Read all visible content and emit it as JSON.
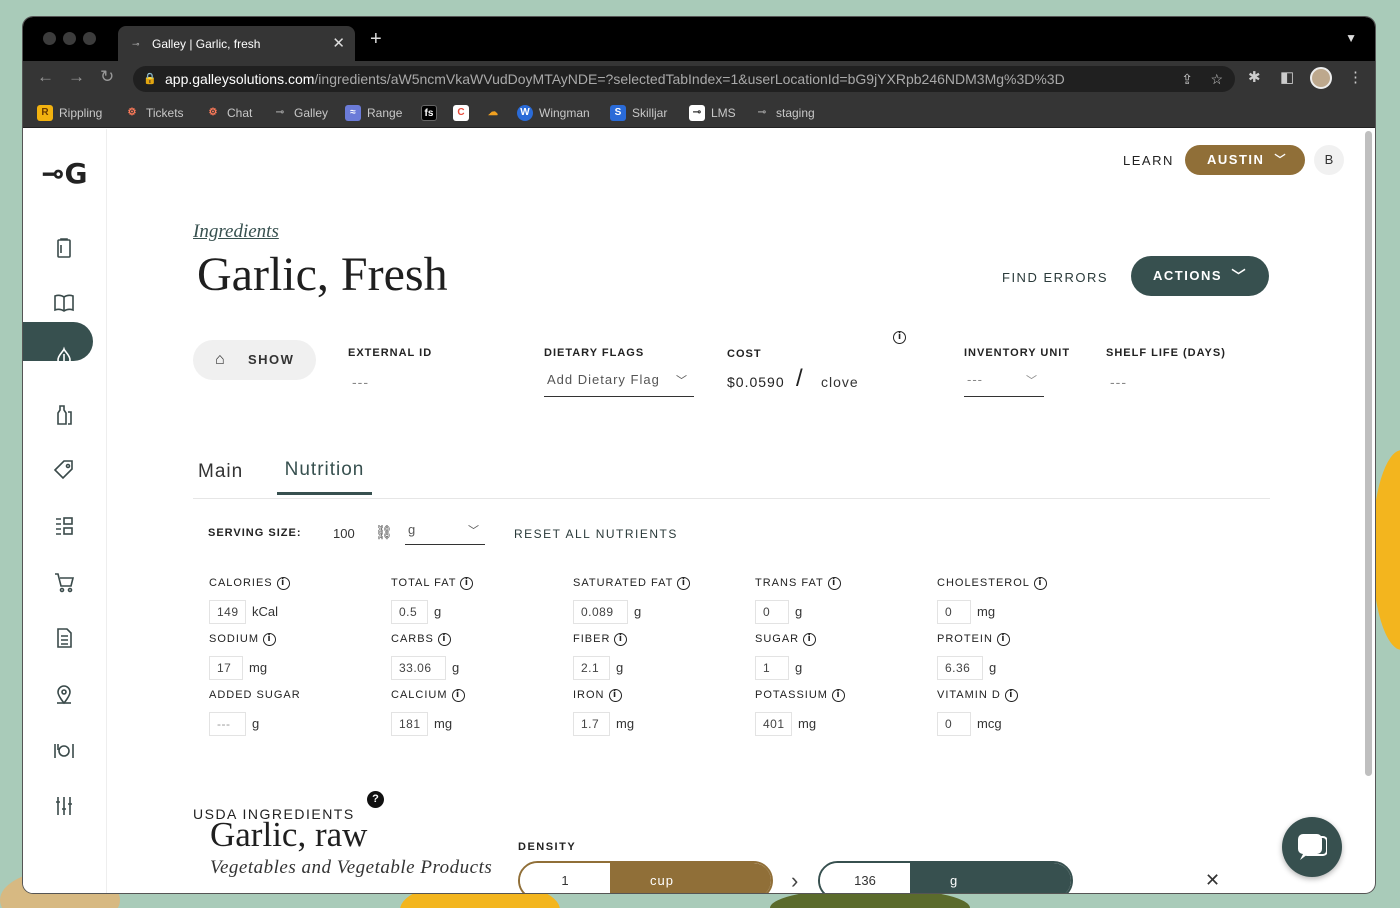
{
  "browser": {
    "tab_title": "Galley | Garlic, fresh",
    "url_host": "app.galleysolutions.com",
    "url_path": "/ingredients/aW5ncmVkaWVudDoyMTAyNDE=?selectedTabIndex=1&userLocationId=bG9jYXRpb246NDM3Mg%3D%3D",
    "bookmarks": [
      {
        "label": "Rippling",
        "icon": "rippling-icon",
        "color": "#f2b20f"
      },
      {
        "label": "Tickets",
        "icon": "hubspot-icon",
        "color": "#ff7a59"
      },
      {
        "label": "Chat",
        "icon": "hubspot-icon",
        "color": "#ff7a59"
      },
      {
        "label": "Galley",
        "icon": "galley-icon",
        "color": "#999999"
      },
      {
        "label": "Range",
        "icon": "range-icon",
        "color": "#6b7bd8"
      },
      {
        "label": "",
        "icon": "fullstory-icon",
        "color": "#000000"
      },
      {
        "label": "",
        "icon": "calendar-icon",
        "color": "#e84a3a"
      },
      {
        "label": "",
        "icon": "cloud-icon",
        "color": "#f0a020"
      },
      {
        "label": "Wingman",
        "icon": "wingman-icon",
        "color": "#2a6bd8"
      },
      {
        "label": "Skilljar",
        "icon": "skilljar-icon",
        "color": "#2a6bd8"
      },
      {
        "label": "LMS",
        "icon": "lms-icon",
        "color": "#ffffff"
      },
      {
        "label": "staging",
        "icon": "galley-icon",
        "color": "#999999"
      }
    ]
  },
  "header": {
    "learn": "LEARN",
    "location": "AUSTIN",
    "user_initial": "B"
  },
  "page": {
    "breadcrumb": "Ingredients",
    "title": "Garlic, Fresh",
    "find_errors": "FIND ERRORS",
    "actions": "ACTIONS",
    "show": "SHOW"
  },
  "fields": {
    "external_id_label": "EXTERNAL ID",
    "external_id_value": "---",
    "dietary_label": "DIETARY FLAGS",
    "dietary_placeholder": "Add Dietary Flag",
    "cost_label": "COST",
    "cost_value": "$0.0590",
    "cost_unit": "clove",
    "inventory_label": "INVENTORY UNIT",
    "inventory_value": "---",
    "shelf_label": "SHELF LIFE (DAYS)",
    "shelf_value": "---"
  },
  "tabs": {
    "main": "Main",
    "nutrition": "Nutrition"
  },
  "serving": {
    "label": "SERVING SIZE:",
    "value": "100",
    "unit": "g",
    "reset": "RESET ALL NUTRIENTS"
  },
  "nutrients": [
    {
      "label": "CALORIES",
      "value": "149",
      "unit": "kCal",
      "info": true
    },
    {
      "label": "TOTAL FAT",
      "value": "0.5",
      "unit": "g",
      "info": true
    },
    {
      "label": "SATURATED FAT",
      "value": "0.089",
      "unit": "g",
      "info": true
    },
    {
      "label": "TRANS FAT",
      "value": "0",
      "unit": "g",
      "info": true
    },
    {
      "label": "CHOLESTEROL",
      "value": "0",
      "unit": "mg",
      "info": true
    },
    {
      "label": "SODIUM",
      "value": "17",
      "unit": "mg",
      "info": true
    },
    {
      "label": "CARBS",
      "value": "33.06",
      "unit": "g",
      "info": true
    },
    {
      "label": "FIBER",
      "value": "2.1",
      "unit": "g",
      "info": true
    },
    {
      "label": "SUGAR",
      "value": "1",
      "unit": "g",
      "info": true
    },
    {
      "label": "PROTEIN",
      "value": "6.36",
      "unit": "g",
      "info": true
    },
    {
      "label": "ADDED SUGAR",
      "value": "---",
      "unit": "g",
      "info": false
    },
    {
      "label": "CALCIUM",
      "value": "181",
      "unit": "mg",
      "info": true
    },
    {
      "label": "IRON",
      "value": "1.7",
      "unit": "mg",
      "info": true
    },
    {
      "label": "POTASSIUM",
      "value": "401",
      "unit": "mg",
      "info": true
    },
    {
      "label": "VITAMIN D",
      "value": "0",
      "unit": "mcg",
      "info": true
    }
  ],
  "usda": {
    "heading": "USDA INGREDIENTS",
    "name": "Garlic, raw",
    "category": "Vegetables and Vegetable Products",
    "density_label": "DENSITY",
    "from_amount": "1",
    "from_unit": "cup",
    "to_amount": "136",
    "to_unit": "g"
  },
  "colors": {
    "primary": "#37504f",
    "accent": "#906f38"
  }
}
